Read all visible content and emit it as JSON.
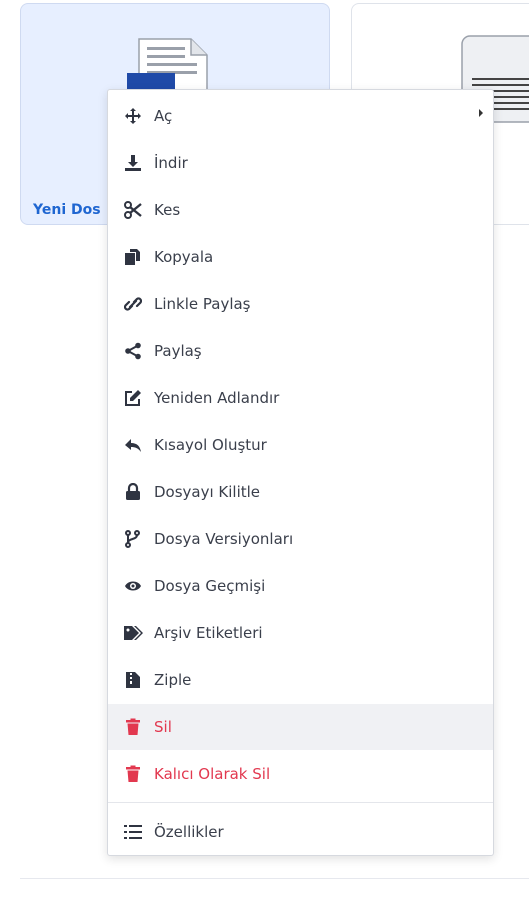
{
  "card": {
    "name": "Yeni Dos"
  },
  "menu": {
    "items": [
      {
        "label": "Aç",
        "icon": "move-arrows-icon"
      },
      {
        "label": "İndir",
        "icon": "download-icon"
      },
      {
        "label": "Kes",
        "icon": "scissors-icon"
      },
      {
        "label": "Kopyala",
        "icon": "copy-icon"
      },
      {
        "label": "Linkle Paylaş",
        "icon": "link-icon"
      },
      {
        "label": "Paylaş",
        "icon": "share-icon"
      },
      {
        "label": "Yeniden Adlandır",
        "icon": "edit-icon"
      },
      {
        "label": "Kısayol Oluştur",
        "icon": "reply-arrow-icon"
      },
      {
        "label": "Dosyayı Kilitle",
        "icon": "lock-icon"
      },
      {
        "label": "Dosya Versiyonları",
        "icon": "code-branch-icon"
      },
      {
        "label": "Dosya Geçmişi",
        "icon": "eye-icon"
      },
      {
        "label": "Arşiv Etiketleri",
        "icon": "tags-icon"
      },
      {
        "label": "Ziple",
        "icon": "zip-file-icon"
      },
      {
        "label": "Sil",
        "icon": "trash-icon"
      },
      {
        "label": "Kalıcı Olarak Sil",
        "icon": "trash-icon"
      },
      {
        "label": "Özellikler",
        "icon": "list-icon"
      }
    ]
  },
  "colors": {
    "accent": "#1f66d1",
    "danger": "#e2384f",
    "icon": "#2f3441"
  }
}
